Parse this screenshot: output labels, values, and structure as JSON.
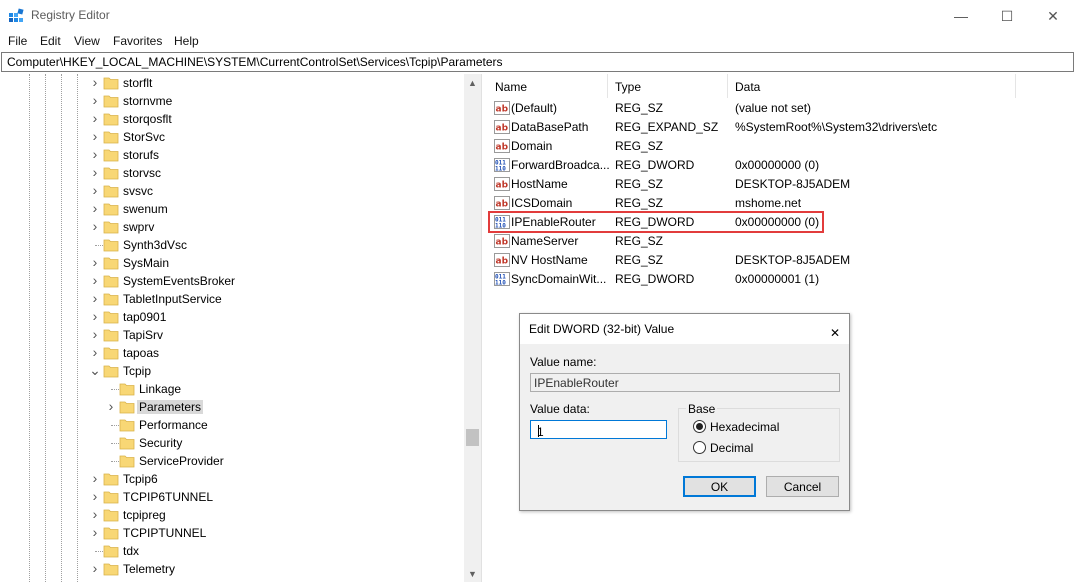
{
  "window": {
    "title": "Registry Editor",
    "controls": {
      "minimize": "—",
      "maximize": "☐",
      "close": "✕"
    }
  },
  "menu": [
    "File",
    "Edit",
    "View",
    "Favorites",
    "Help"
  ],
  "address": "Computer\\HKEY_LOCAL_MACHINE\\SYSTEM\\CurrentControlSet\\Services\\Tcpip\\Parameters",
  "tree": [
    {
      "label": "storflt",
      "level": 0,
      "expander": "collapsed"
    },
    {
      "label": "stornvme",
      "level": 0,
      "expander": "collapsed"
    },
    {
      "label": "storqosflt",
      "level": 0,
      "expander": "collapsed"
    },
    {
      "label": "StorSvc",
      "level": 0,
      "expander": "collapsed"
    },
    {
      "label": "storufs",
      "level": 0,
      "expander": "collapsed"
    },
    {
      "label": "storvsc",
      "level": 0,
      "expander": "collapsed"
    },
    {
      "label": "svsvc",
      "level": 0,
      "expander": "collapsed"
    },
    {
      "label": "swenum",
      "level": 0,
      "expander": "collapsed"
    },
    {
      "label": "swprv",
      "level": 0,
      "expander": "collapsed"
    },
    {
      "label": "Synth3dVsc",
      "level": 0,
      "expander": "none"
    },
    {
      "label": "SysMain",
      "level": 0,
      "expander": "collapsed"
    },
    {
      "label": "SystemEventsBroker",
      "level": 0,
      "expander": "collapsed"
    },
    {
      "label": "TabletInputService",
      "level": 0,
      "expander": "collapsed"
    },
    {
      "label": "tap0901",
      "level": 0,
      "expander": "collapsed"
    },
    {
      "label": "TapiSrv",
      "level": 0,
      "expander": "collapsed"
    },
    {
      "label": "tapoas",
      "level": 0,
      "expander": "collapsed"
    },
    {
      "label": "Tcpip",
      "level": 0,
      "expander": "expanded"
    },
    {
      "label": "Linkage",
      "level": 1,
      "expander": "none"
    },
    {
      "label": "Parameters",
      "level": 1,
      "expander": "collapsed",
      "selected": true
    },
    {
      "label": "Performance",
      "level": 1,
      "expander": "none"
    },
    {
      "label": "Security",
      "level": 1,
      "expander": "none"
    },
    {
      "label": "ServiceProvider",
      "level": 1,
      "expander": "none"
    },
    {
      "label": "Tcpip6",
      "level": 0,
      "expander": "collapsed"
    },
    {
      "label": "TCPIP6TUNNEL",
      "level": 0,
      "expander": "collapsed"
    },
    {
      "label": "tcpipreg",
      "level": 0,
      "expander": "collapsed"
    },
    {
      "label": "TCPIPTUNNEL",
      "level": 0,
      "expander": "collapsed"
    },
    {
      "label": "tdx",
      "level": 0,
      "expander": "none"
    },
    {
      "label": "Telemetry",
      "level": 0,
      "expander": "collapsed"
    }
  ],
  "list": {
    "columns": [
      "Name",
      "Type",
      "Data"
    ],
    "rows": [
      {
        "icon": "string-value-icon",
        "name": "(Default)",
        "type": "REG_SZ",
        "data": "(value not set)"
      },
      {
        "icon": "string-value-icon",
        "name": "DataBasePath",
        "type": "REG_EXPAND_SZ",
        "data": "%SystemRoot%\\System32\\drivers\\etc"
      },
      {
        "icon": "string-value-icon",
        "name": "Domain",
        "type": "REG_SZ",
        "data": ""
      },
      {
        "icon": "binary-value-icon",
        "name": "ForwardBroadca...",
        "type": "REG_DWORD",
        "data": "0x00000000 (0)"
      },
      {
        "icon": "string-value-icon",
        "name": "HostName",
        "type": "REG_SZ",
        "data": "DESKTOP-8J5ADEM"
      },
      {
        "icon": "string-value-icon",
        "name": "ICSDomain",
        "type": "REG_SZ",
        "data": "mshome.net"
      },
      {
        "icon": "binary-value-icon",
        "name": "IPEnableRouter",
        "type": "REG_DWORD",
        "data": "0x00000000 (0)",
        "highlighted": true
      },
      {
        "icon": "string-value-icon",
        "name": "NameServer",
        "type": "REG_SZ",
        "data": ""
      },
      {
        "icon": "string-value-icon",
        "name": "NV HostName",
        "type": "REG_SZ",
        "data": "DESKTOP-8J5ADEM"
      },
      {
        "icon": "binary-value-icon",
        "name": "SyncDomainWit...",
        "type": "REG_DWORD",
        "data": "0x00000001 (1)"
      }
    ]
  },
  "dialog": {
    "title": "Edit DWORD (32-bit) Value",
    "value_name_label": "Value name:",
    "value_name": "IPEnableRouter",
    "value_data_label": "Value data:",
    "value_data": "1",
    "base_label": "Base",
    "hex_label": "Hexadecimal",
    "dec_label": "Decimal",
    "base_selected": "Hexadecimal",
    "ok_label": "OK",
    "cancel_label": "Cancel"
  },
  "colors": {
    "highlight_border": "#e23c3c",
    "folder": "#f8d775",
    "accent": "#0078d7"
  }
}
